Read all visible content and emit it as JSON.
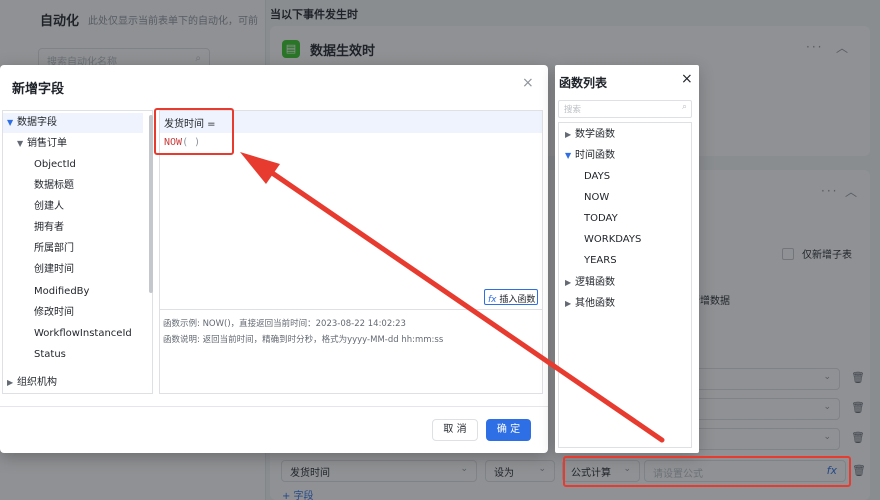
{
  "background": {
    "left_title": "自动化",
    "left_hint": "此处仅显示当前表单下的自动化，可前",
    "search_placeholder": "搜索自动化名称",
    "event_label": "当以下事件发生时",
    "trigger_title": "数据生效时",
    "only_new_subtable": "仅新增子表",
    "new_data_text": "所增数据",
    "row_field": "发货时间",
    "row_set": "设为",
    "row_mode": "公式计算",
    "formula_placeholder": "请设置公式",
    "add_field": "+ 字段",
    "more": "···"
  },
  "dialog": {
    "title": "新增字段",
    "close": "×",
    "tree": {
      "root": "数据字段",
      "group": "销售订单",
      "items": [
        "ObjectId",
        "数据标题",
        "创建人",
        "拥有者",
        "所属部门",
        "创建时间",
        "ModifiedBy",
        "修改时间",
        "WorkflowInstanceId",
        "Status"
      ],
      "collapsed": "组织机构"
    },
    "editor": {
      "line1": "发货时间 =",
      "func": "NOW",
      "parens": "( )",
      "insert_button": "插入函数",
      "example": "函数示例: NOW()，直接返回当前时间：2023-08-22 14:02:23",
      "description": "函数说明: 返回当前时间，精确到时分秒，格式为yyyy-MM-dd hh:mm:ss"
    },
    "cancel": "取 消",
    "confirm": "确 定"
  },
  "function_panel": {
    "title": "函数列表",
    "close": "×",
    "search_placeholder": "搜索",
    "groups": [
      {
        "label": "数学函数",
        "expanded": false
      },
      {
        "label": "时间函数",
        "expanded": true,
        "items": [
          "DAYS",
          "NOW",
          "TODAY",
          "WORKDAYS",
          "YEARS"
        ]
      },
      {
        "label": "逻辑函数",
        "expanded": false
      },
      {
        "label": "其他函数",
        "expanded": false
      }
    ]
  },
  "colors": {
    "accent": "#2f6fe5",
    "highlight": "#e73b2f",
    "success": "#34c724"
  }
}
